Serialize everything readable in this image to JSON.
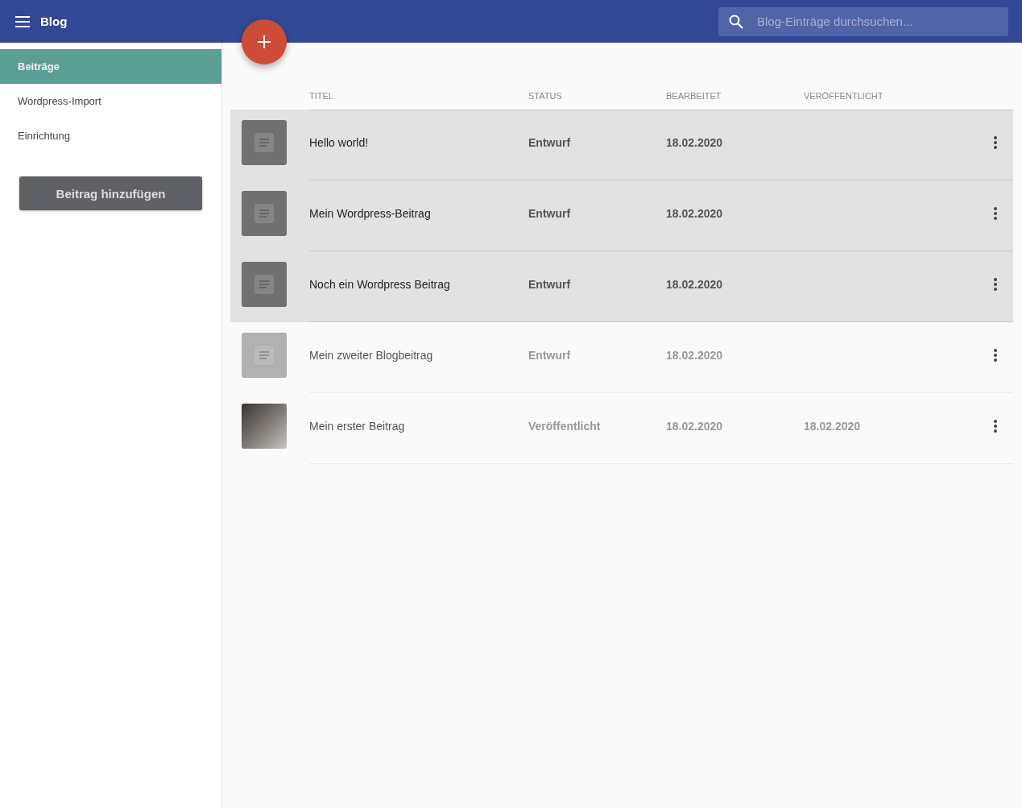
{
  "app_bar": {
    "title": "Blog",
    "search": {
      "placeholder": "Blog-Einträge durchsuchen..."
    }
  },
  "sidebar": {
    "items": [
      {
        "label": "Beiträge",
        "selected": true
      },
      {
        "label": "Wordpress-Import",
        "selected": false
      },
      {
        "label": "Einrichtung",
        "selected": false
      }
    ],
    "add_button": "Beitrag hinzufügen"
  },
  "table": {
    "columns": [
      "TITEL",
      "STATUS",
      "BEARBEITET",
      "VERÖFFENTLICHT"
    ],
    "rows": [
      {
        "kind": "document",
        "title": "Hello world!",
        "status": "Entwurf",
        "edited": "18.02.2020",
        "selected": true
      },
      {
        "kind": "document",
        "title": "Mein Wordpress-Beitrag",
        "status": "Entwurf",
        "edited": "18.02.2020",
        "selected": true
      },
      {
        "kind": "document",
        "title": "Noch ein Wordpress Beitrag",
        "status": "Entwurf",
        "edited": "18.02.2020",
        "selected": true
      },
      {
        "kind": "document",
        "title": "Mein zweiter Blogbeitrag",
        "status": "Entwurf",
        "edited": "18.02.2020",
        "selected": false
      },
      {
        "kind": "photo",
        "title": "Mein erster Beitrag",
        "status": "Veröffentlicht",
        "edited": "18.02.2020",
        "published": "18.02.2020",
        "selected": false
      }
    ]
  }
}
